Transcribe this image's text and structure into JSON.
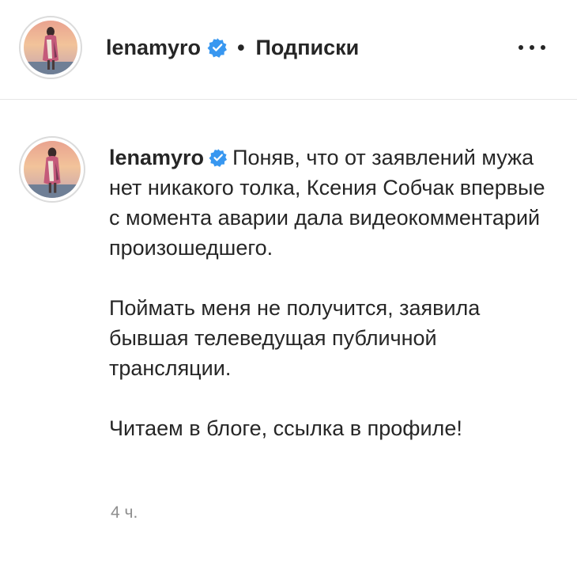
{
  "header": {
    "username": "lenamyro",
    "separator": "•",
    "follow_status": "Подписки",
    "verified_icon": "verified-badge-icon",
    "more_icon": "more-options-icon"
  },
  "post": {
    "username": "lenamyro",
    "paragraphs": [
      "Поняв, что от заявлений мужа нет никакого толка, Ксения Собчак впервые с момента аварии дала видеокомментарий произошедшего.",
      "Поймать меня не получится, заявила бывшая телеведущая публичной трансляции.",
      "Читаем в блоге, ссылка в профиле!"
    ],
    "timestamp": "4 ч."
  },
  "colors": {
    "text": "#262626",
    "muted": "#8e8e8e",
    "verified": "#3897f0",
    "divider": "#e6e6e6"
  }
}
